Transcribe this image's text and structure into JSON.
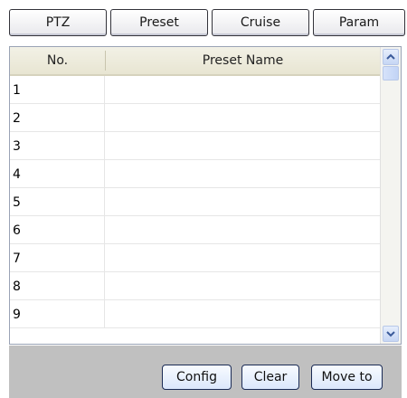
{
  "tabs": [
    {
      "label": "PTZ"
    },
    {
      "label": "Preset"
    },
    {
      "label": "Cruise"
    },
    {
      "label": "Param"
    }
  ],
  "table": {
    "columns": [
      "No.",
      "Preset Name"
    ],
    "rows": [
      {
        "no": "1",
        "name": ""
      },
      {
        "no": "2",
        "name": ""
      },
      {
        "no": "3",
        "name": ""
      },
      {
        "no": "4",
        "name": ""
      },
      {
        "no": "5",
        "name": ""
      },
      {
        "no": "6",
        "name": ""
      },
      {
        "no": "7",
        "name": ""
      },
      {
        "no": "8",
        "name": ""
      },
      {
        "no": "9",
        "name": ""
      }
    ]
  },
  "actions": {
    "config_label": "Config",
    "clear_label": "Clear",
    "move_to_label": "Move to"
  },
  "colors": {
    "header_bg": "#ebe8d6",
    "bottom_bar_bg": "#c0c0c0",
    "scrollbar_accent": "#c6d6f4"
  }
}
